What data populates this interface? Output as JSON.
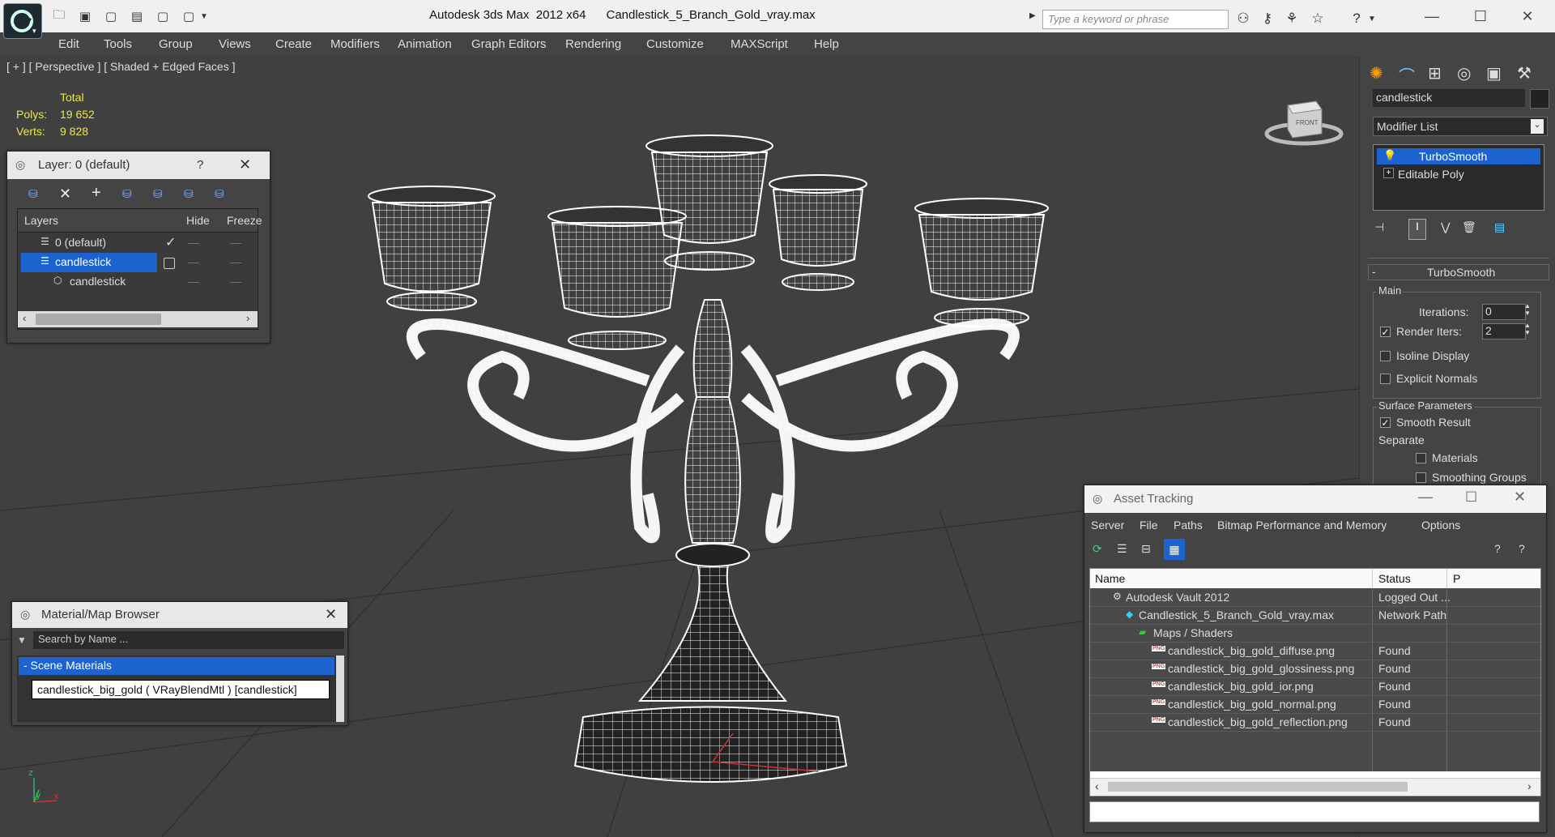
{
  "titlebar": {
    "app_title": "Autodesk 3ds Max  2012 x64",
    "file_title": "Candlestick_5_Branch_Gold_vray.max",
    "search_placeholder": "Type a keyword or phrase"
  },
  "menu": [
    "Edit",
    "Tools",
    "Group",
    "Views",
    "Create",
    "Modifiers",
    "Animation",
    "Graph Editors",
    "Rendering",
    "Customize",
    "MAXScript",
    "Help"
  ],
  "viewport": {
    "label": "[ + ] [ Perspective ] [ Shaded + Edged Faces ]",
    "stats_header": "Total",
    "polys_label": "Polys:",
    "polys_value": "19 652",
    "verts_label": "Verts:",
    "verts_value": "9 828",
    "viewcube_face": "FRONT"
  },
  "layer_window": {
    "title": "Layer: 0 (default)",
    "help": "?",
    "columns": [
      "Layers",
      "Hide",
      "Freeze"
    ],
    "rows": [
      {
        "name": "0 (default)",
        "active": true
      },
      {
        "name": "candlestick",
        "selected": true
      },
      {
        "name": "candlestick",
        "child": true
      }
    ]
  },
  "material_browser": {
    "title": "Material/Map Browser",
    "search_placeholder": "Search by Name ...",
    "group": "- Scene Materials",
    "item": "candlestick_big_gold ( VRayBlendMtl ) [candlestick]"
  },
  "command_panel": {
    "object_name": "candlestick",
    "modifier_list": "Modifier List",
    "stack": [
      "TurboSmooth",
      "Editable Poly"
    ],
    "rollout_title": "TurboSmooth",
    "main_group": "Main",
    "iterations_label": "Iterations:",
    "iterations_value": "0",
    "render_iters_label": "Render Iters:",
    "render_iters_value": "2",
    "isoline_label": "Isoline Display",
    "explicit_label": "Explicit Normals",
    "surface_group": "Surface Parameters",
    "smooth_result_label": "Smooth Result",
    "separate_label": "Separate",
    "materials_label": "Materials",
    "smoothing_label": "Smoothing Groups"
  },
  "asset_tracking": {
    "title": "Asset Tracking",
    "menu": [
      "Server",
      "File",
      "Paths",
      "Bitmap Performance and Memory",
      "Options"
    ],
    "columns": [
      "Name",
      "Status",
      "P"
    ],
    "rows": [
      {
        "name": "Autodesk Vault 2012",
        "status": "Logged Out ...",
        "indent": 0,
        "icon": "vault"
      },
      {
        "name": "Candlestick_5_Branch_Gold_vray.max",
        "status": "Network Path",
        "indent": 1,
        "icon": "max"
      },
      {
        "name": "Maps / Shaders",
        "status": "",
        "indent": 2,
        "icon": "maps"
      },
      {
        "name": "candlestick_big_gold_diffuse.png",
        "status": "Found",
        "indent": 3,
        "icon": "png"
      },
      {
        "name": "candlestick_big_gold_glossiness.png",
        "status": "Found",
        "indent": 3,
        "icon": "png"
      },
      {
        "name": "candlestick_big_gold_ior.png",
        "status": "Found",
        "indent": 3,
        "icon": "png"
      },
      {
        "name": "candlestick_big_gold_normal.png",
        "status": "Found",
        "indent": 3,
        "icon": "png"
      },
      {
        "name": "candlestick_big_gold_reflection.png",
        "status": "Found",
        "indent": 3,
        "icon": "png"
      }
    ]
  },
  "colors": {
    "selection": "#1c63d0",
    "stats": "#e8e84a",
    "wireframe": "#ffffff"
  }
}
